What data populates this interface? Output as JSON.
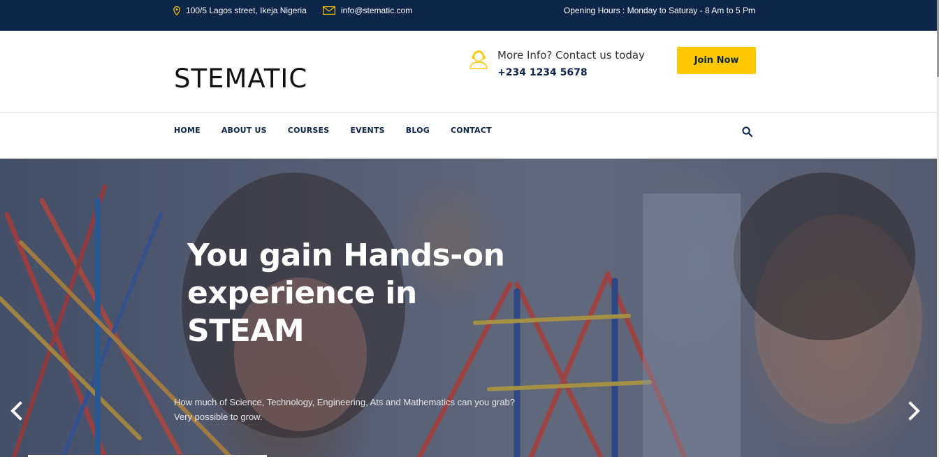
{
  "topbar": {
    "address": "100/5 Lagos street, Ikeja Nigeria",
    "email": "info@stematic.com",
    "hours": "Opening Hours : Monday to Saturay - 8 Am to 5 Pm"
  },
  "header": {
    "logo": "STEMATIC",
    "contact_label": "More Info? Contact us today",
    "contact_phone": "+234 1234 5678",
    "join_label": "Join Now"
  },
  "nav": {
    "items": [
      "HOME",
      "ABOUT US",
      "COURSES",
      "EVENTS",
      "BLOG",
      "CONTACT"
    ]
  },
  "hero": {
    "heading_line1": "You gain Hands-on",
    "heading_line2": "experience in",
    "heading_line3": "STEAM",
    "subtext": "How much of Science, Technology, Engineering, Ats and Mathematics can you grab? Very possible to grow."
  },
  "colors": {
    "topbar_bg": "#0c2549",
    "accent": "#fdc800",
    "nav_text": "#0c2549"
  },
  "icons": {
    "address": "map-pin-icon",
    "email": "envelope-icon",
    "contact": "support-agent-icon",
    "search": "search-icon",
    "prev": "chevron-left-icon",
    "next": "chevron-right-icon"
  }
}
